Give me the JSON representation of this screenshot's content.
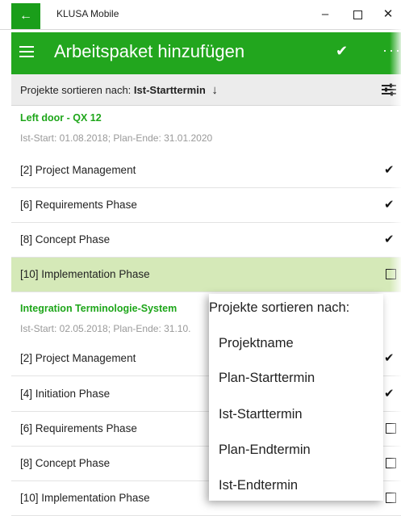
{
  "window": {
    "back_icon": "←",
    "title": "KLUSA Mobile",
    "minimize_icon": "–",
    "close_icon": "✕"
  },
  "header": {
    "title": "Arbeitspaket hinzufügen",
    "confirm_icon": "✔",
    "more_icon": "···"
  },
  "sort": {
    "label": "Projekte sortieren nach:",
    "value": "Ist-Starttermin",
    "direction_icon": "↓"
  },
  "projects": [
    {
      "title": "Left door - QX 12",
      "meta": "Ist-Start: 01.08.2018; Plan-Ende: 31.01.2020",
      "packages": [
        {
          "label": "[2] Project Management",
          "checked": true
        },
        {
          "label": "[6] Requirements Phase",
          "checked": true
        },
        {
          "label": "[8] Concept Phase",
          "checked": true
        },
        {
          "label": "[10] Implementation Phase",
          "checked": false
        }
      ]
    },
    {
      "title": "Integration Terminologie-System",
      "meta": "Ist-Start: 02.05.2018; Plan-Ende: 31.10.",
      "packages": [
        {
          "label": "[2] Project Management",
          "checked": true
        },
        {
          "label": "[4] Initiation Phase",
          "checked": true
        },
        {
          "label": "[6] Requirements Phase",
          "checked": false
        },
        {
          "label": "[8] Concept Phase",
          "checked": false
        },
        {
          "label": "[10] Implementation Phase",
          "checked": false
        }
      ]
    }
  ],
  "sort_popup": {
    "title": "Projekte sortieren nach:",
    "options": [
      "Projektname",
      "Plan-Starttermin",
      "Ist-Starttermin",
      "Plan-Endtermin",
      "Ist-Endtermin"
    ]
  },
  "colors": {
    "accent": "#22a61e",
    "selected_row": "#d5e9b8"
  }
}
